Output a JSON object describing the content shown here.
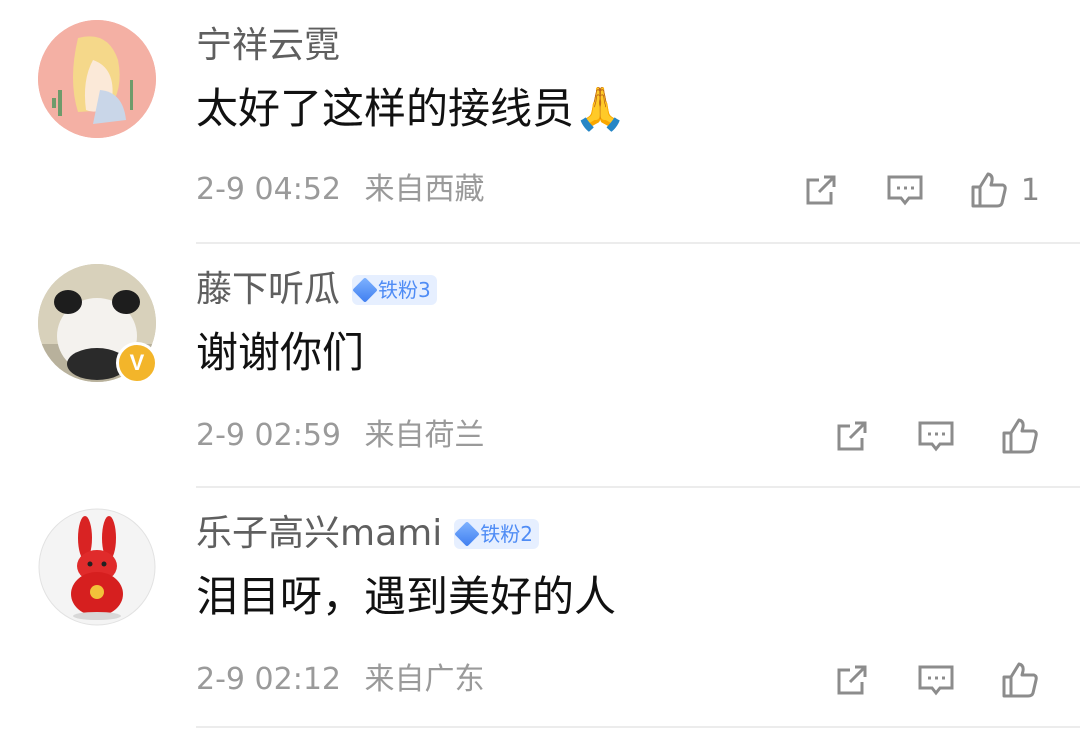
{
  "comments": [
    {
      "user": "宁祥云霓",
      "badge": "",
      "text": "太好了这样的接线员🙏",
      "time": "2-9 04:52",
      "location": "来自西藏",
      "likes": "1",
      "avatar": "girl-illustration-avatar",
      "verified": false
    },
    {
      "user": "藤下听瓜",
      "badge": "铁粉3",
      "text": "谢谢你们",
      "time": "2-9 02:59",
      "location": "来自荷兰",
      "likes": "",
      "avatar": "panda-avatar",
      "verified": true
    },
    {
      "user": "乐子高兴mami",
      "badge": "铁粉2",
      "text": "泪目呀，遇到美好的人",
      "time": "2-9 02:12",
      "location": "来自广东",
      "likes": "",
      "avatar": "red-rabbit-avatar",
      "verified": false
    }
  ],
  "verified_badge_glyph": "V",
  "colors": {
    "username": "#5f5f5f",
    "content": "#111111",
    "meta": "#9a9a9a",
    "badge_text": "#4f8cf5",
    "badge_bg": "#e6efff",
    "verified": "#f3b52a"
  }
}
